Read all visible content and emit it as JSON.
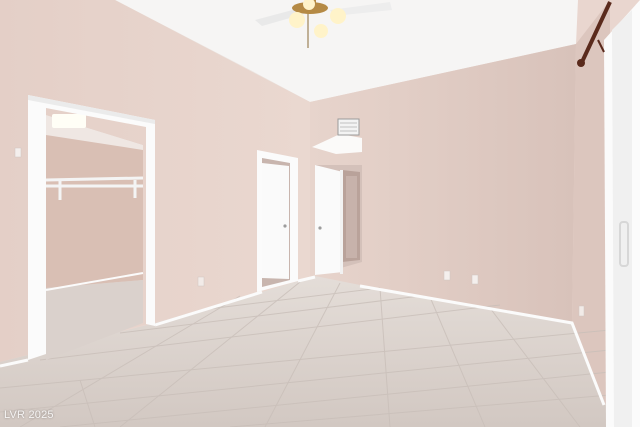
{
  "photo": {
    "watermark": "LVR 2025",
    "palette": {
      "wall": "#e6d2ca",
      "wall_shadow": "#d9c3bb",
      "ceiling": "#f7f6f5",
      "floor": "#d9d0cb",
      "trim": "#fbfbfb",
      "door": "#fafafa",
      "fixture_brass": "#b58a45",
      "curtain_rod": "#5a2a1c"
    }
  }
}
